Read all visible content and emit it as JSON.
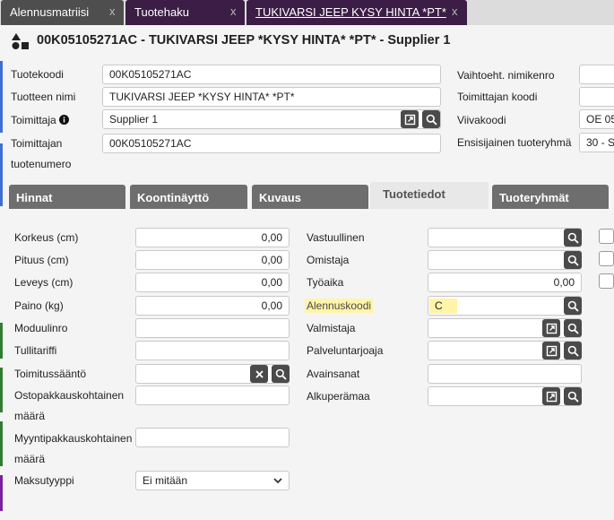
{
  "window_tabs": [
    {
      "label": "Alennusmatriisi",
      "close": "x"
    },
    {
      "label": "Tuotehaku",
      "close": "x"
    },
    {
      "label": "TUKIVARSI JEEP KYSY HINTA *PT*",
      "close": "x"
    }
  ],
  "header": {
    "title": "00K05105271AC - TUKIVARSI JEEP *KYSY HINTA* *PT* - Supplier 1"
  },
  "product": {
    "code_label": "Tuotekoodi",
    "code_value": "00K05105271AC",
    "name_label": "Tuotteen nimi",
    "name_value": "TUKIVARSI JEEP *KYSY HINTA* *PT*",
    "supplier_label": "Toimittaja",
    "supplier_value": "Supplier 1",
    "supplier_number_label_1": "Toimittajan",
    "supplier_number_label_2": "tuotenumero",
    "supplier_number_value": "00K05105271AC",
    "alt_item_label": "Vaihtoeht. nimikenro",
    "supplier_code_label": "Toimittajan koodi",
    "barcode_label": "Viivakoodi",
    "barcode_value": "OE 05",
    "primary_group_label": "Ensisijainen tuoteryhmä",
    "primary_group_value": "30 - S"
  },
  "section_tabs": [
    "Hinnat",
    "Koontinäyttö",
    "Kuvaus",
    "Tuotetiedot",
    "Tuoteryhmät"
  ],
  "active_tab": "Tuotetiedot",
  "details_left": {
    "height_label": "Korkeus (cm)",
    "height_value": "0,00",
    "length_label": "Pituus (cm)",
    "length_value": "0,00",
    "width_label": "Leveys (cm)",
    "width_value": "0,00",
    "weight_label": "Paino (kg)",
    "weight_value": "0,00",
    "module_label": "Moduulinro",
    "tariff_label": "Tullitariffi",
    "delivery_rule_label": "Toimitussääntö",
    "purchase_pack_label_1": "Ostopakkauskohtainen",
    "purchase_pack_label_2": "määrä",
    "sales_pack_label_1": "Myyntipakkauskohtainen",
    "sales_pack_label_2": "määrä",
    "payment_type_label": "Maksutyyppi",
    "payment_type_value": "Ei mitään"
  },
  "details_right": {
    "responsible_label": "Vastuullinen",
    "owner_label": "Omistaja",
    "worktime_label": "Työaika",
    "worktime_value": "0,00",
    "discount_code_label": "Alennuskoodi",
    "discount_code_value": "C",
    "manufacturer_label": "Valmistaja",
    "service_provider_label": "Palveluntarjoaja",
    "keywords_label": "Avainsanat",
    "origin_label": "Alkuperämaa"
  },
  "colors": {
    "purple_tab": "#3c1d45",
    "grey_tab": "#6e6e6e",
    "icon_button": "#4a4a4a",
    "highlight": "#fff4a8"
  },
  "left_strip_colors": [
    "#3d6fd6",
    "#2f7d32",
    "#7b1fa2"
  ]
}
